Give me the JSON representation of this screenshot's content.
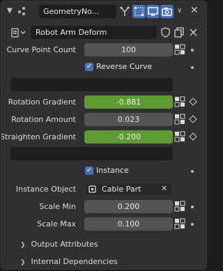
{
  "header": {
    "modifier_name": "GeometryNo...",
    "visibility_icons": [
      "edit-mode-icon",
      "on-cage-icon",
      "viewport-icon",
      "render-icon"
    ]
  },
  "node_group": {
    "name": "Robot Arm Deform"
  },
  "inputs": {
    "curve_point_count": {
      "label": "Curve Point Count",
      "value": "100"
    },
    "reverse_curve": {
      "label": "Reverse Curve",
      "checked": true
    },
    "rotation_gradient": {
      "label": "Rotation Gradient",
      "value": "-0.881"
    },
    "rotation_amount": {
      "label": "Rotation Amount",
      "value": "0.023"
    },
    "straighten_gradient": {
      "label": "Straighten Gradient",
      "value": "-0.200"
    },
    "instance": {
      "label": "Instance",
      "checked": true
    },
    "instance_object": {
      "label": "Instance Object",
      "value": "Cable Part"
    },
    "scale_min": {
      "label": "Scale Min",
      "value": "0.200"
    },
    "scale_max": {
      "label": "Scale Max",
      "value": "0.100"
    }
  },
  "subpanels": {
    "output_attributes": "Output Attributes",
    "internal_dependencies": "Internal Dependencies"
  },
  "colors": {
    "panel_bg": "#303030",
    "field_bg": "#545454",
    "attribute_green": "#5f9a34",
    "accent_blue": "#4772b3"
  }
}
